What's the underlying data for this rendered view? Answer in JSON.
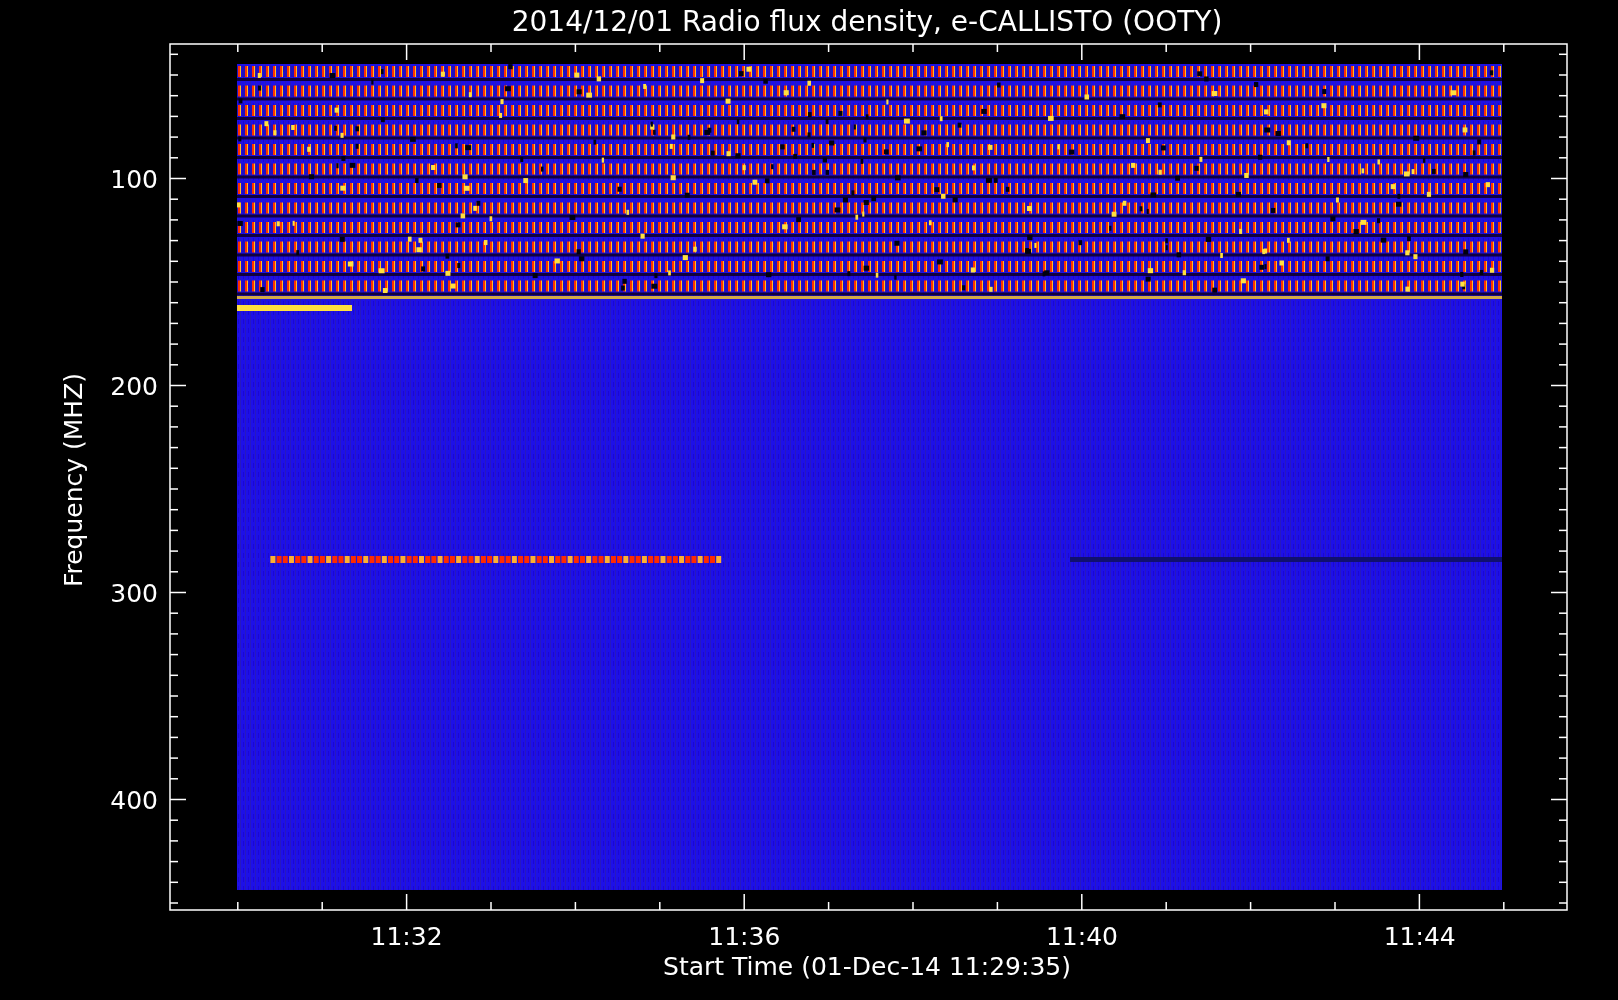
{
  "title": "2014/12/01  Radio flux density, e-CALLISTO (OOTY)",
  "y_axis": {
    "label": "Frequency (MHZ)",
    "ticks": [
      "100",
      "200",
      "300",
      "400"
    ]
  },
  "x_axis": {
    "label": "Start Time (01-Dec-14 11:29:35)",
    "ticks": [
      "11:32",
      "11:36",
      "11:40",
      "11:44"
    ]
  }
}
